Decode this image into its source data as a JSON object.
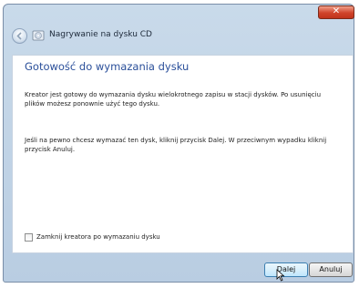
{
  "window": {
    "close_label": "✕"
  },
  "header": {
    "title": "Nagrywanie na dysku CD"
  },
  "main": {
    "heading": "Gotowość do wymazania dysku",
    "paragraph1": "Kreator jest gotowy do wymazania dysku wielokrotnego zapisu w stacji dysków. Po usunięciu plików możesz ponownie użyć tego dysku.",
    "paragraph2": "Jeśli na pewno chcesz wymazać ten dysk, kliknij przycisk Dalej. W przeciwnym wypadku kliknij przycisk Anuluj.",
    "checkbox": {
      "label": "Zamknij kreatora po wymazaniu dysku",
      "checked": false
    }
  },
  "footer": {
    "next_label": "Dalej",
    "cancel_label": "Anuluj"
  },
  "colors": {
    "heading": "#2a4f9a",
    "frame": "#c9daea",
    "close": "#d0432a"
  }
}
